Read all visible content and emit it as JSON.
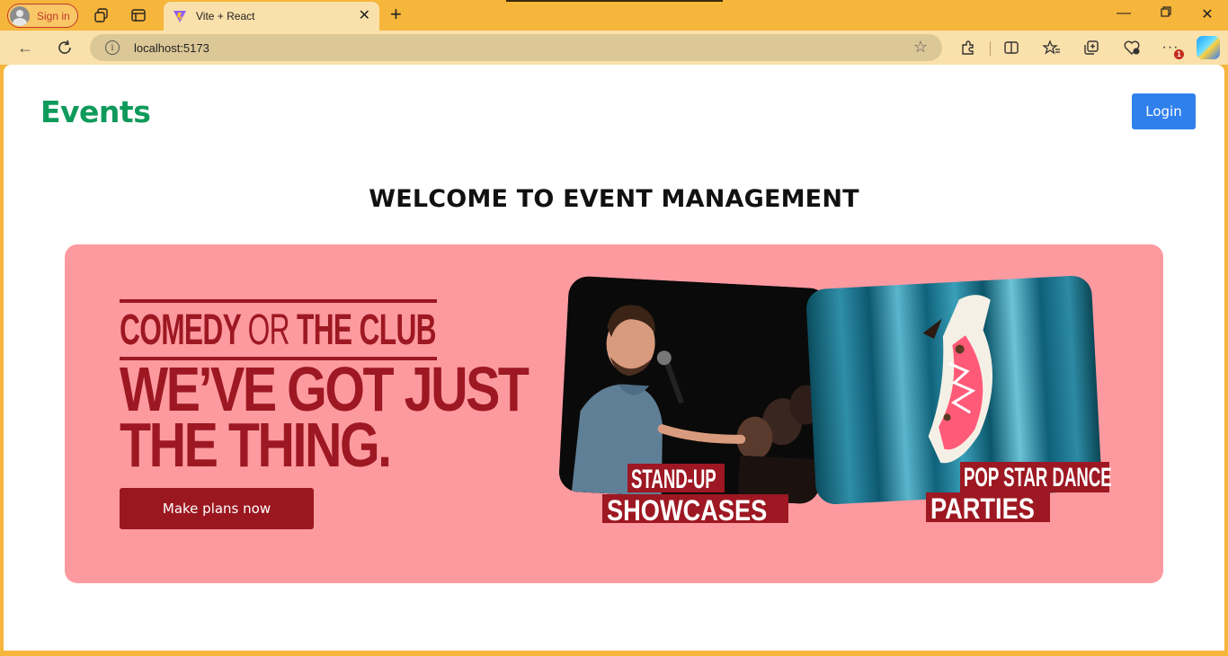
{
  "browser": {
    "sign_in_label": "Sign in",
    "tab": {
      "title": "Vite + React",
      "favicon": "vite-logo-icon"
    },
    "address": {
      "url": "localhost:5173"
    },
    "notification_count": "1",
    "colors": {
      "frame": "#f6b53b",
      "toolbar": "#fae0aa",
      "url_field": "#dcc797"
    }
  },
  "page": {
    "brand": "Events",
    "login_label": "Login",
    "welcome_heading": "WELCOME TO EVENT MANAGEMENT",
    "banner": {
      "line1_a": "COMEDY",
      "line1_or": "OR",
      "line1_b": "THE CLUB",
      "headline_1": "WE’VE GOT JUST",
      "headline_2": "THE THING.",
      "cta_label": "Make plans now",
      "card_comedy": {
        "caption_top": "STAND-UP",
        "caption_bottom": "SHOWCASES"
      },
      "card_dance": {
        "caption_top": "POP STAR DANCE",
        "caption_bottom": "PARTIES"
      }
    },
    "colors": {
      "brand": "#0f9a5c",
      "login": "#2f80ed",
      "banner_bg": "#fd9aa0",
      "banner_text": "#9d1822"
    }
  }
}
